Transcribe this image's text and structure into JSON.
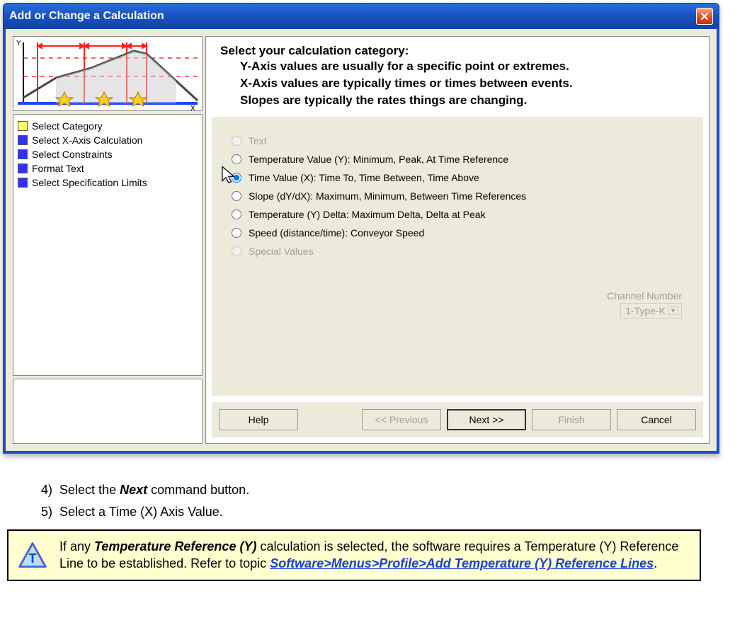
{
  "dialog": {
    "title": "Add or Change a Calculation"
  },
  "steps_list": [
    {
      "color": "yellow",
      "label": "Select Category"
    },
    {
      "color": "blue",
      "label": "Select X-Axis Calculation"
    },
    {
      "color": "blue",
      "label": "Select Constraints"
    },
    {
      "color": "blue",
      "label": "Format Text"
    },
    {
      "color": "blue",
      "label": "Select Specification Limits"
    }
  ],
  "heading": {
    "title": "Select your calculation category:",
    "line1": "Y-Axis values are usually for a specific point or extremes.",
    "line2": "X-Axis values are typically times or times between events.",
    "line3": "Slopes are typically the rates things are changing."
  },
  "radios": [
    {
      "label": "Text",
      "enabled": false,
      "checked": false
    },
    {
      "label": "Temperature Value (Y):  Minimum, Peak, At Time Reference",
      "enabled": true,
      "checked": false
    },
    {
      "label": "Time Value (X):  Time To, Time Between, Time Above",
      "enabled": true,
      "checked": true
    },
    {
      "label": "Slope (dY/dX):  Maximum, Minimum, Between Time References",
      "enabled": true,
      "checked": false
    },
    {
      "label": "Temperature (Y) Delta:  Maximum Delta, Delta at Peak",
      "enabled": true,
      "checked": false
    },
    {
      "label": "Speed (distance/time): Conveyor Speed",
      "enabled": true,
      "checked": false
    },
    {
      "label": "Special  Values",
      "enabled": false,
      "checked": false
    }
  ],
  "channel": {
    "label": "Channel Number",
    "value": "1-Type-K"
  },
  "buttons": {
    "help": "Help",
    "previous": "<< Previous",
    "next": "Next >>",
    "finish": "Finish",
    "cancel": "Cancel"
  },
  "doc": {
    "step4_num": "4)",
    "step4": "Select the ",
    "step4_bold": "Next",
    "step4_after": " command button.",
    "step5_num": "5)",
    "step5": "Select a Time (X) Axis Value."
  },
  "note": {
    "pre": "If any ",
    "bold": "Temperature Reference (Y)",
    "mid": " calculation is selected, the software requires a Temperature (Y) Reference Line to be established. Refer to topic ",
    "link": "Software>Menus>Profile>Add Temperature (Y) Reference Lines",
    "post": "."
  }
}
